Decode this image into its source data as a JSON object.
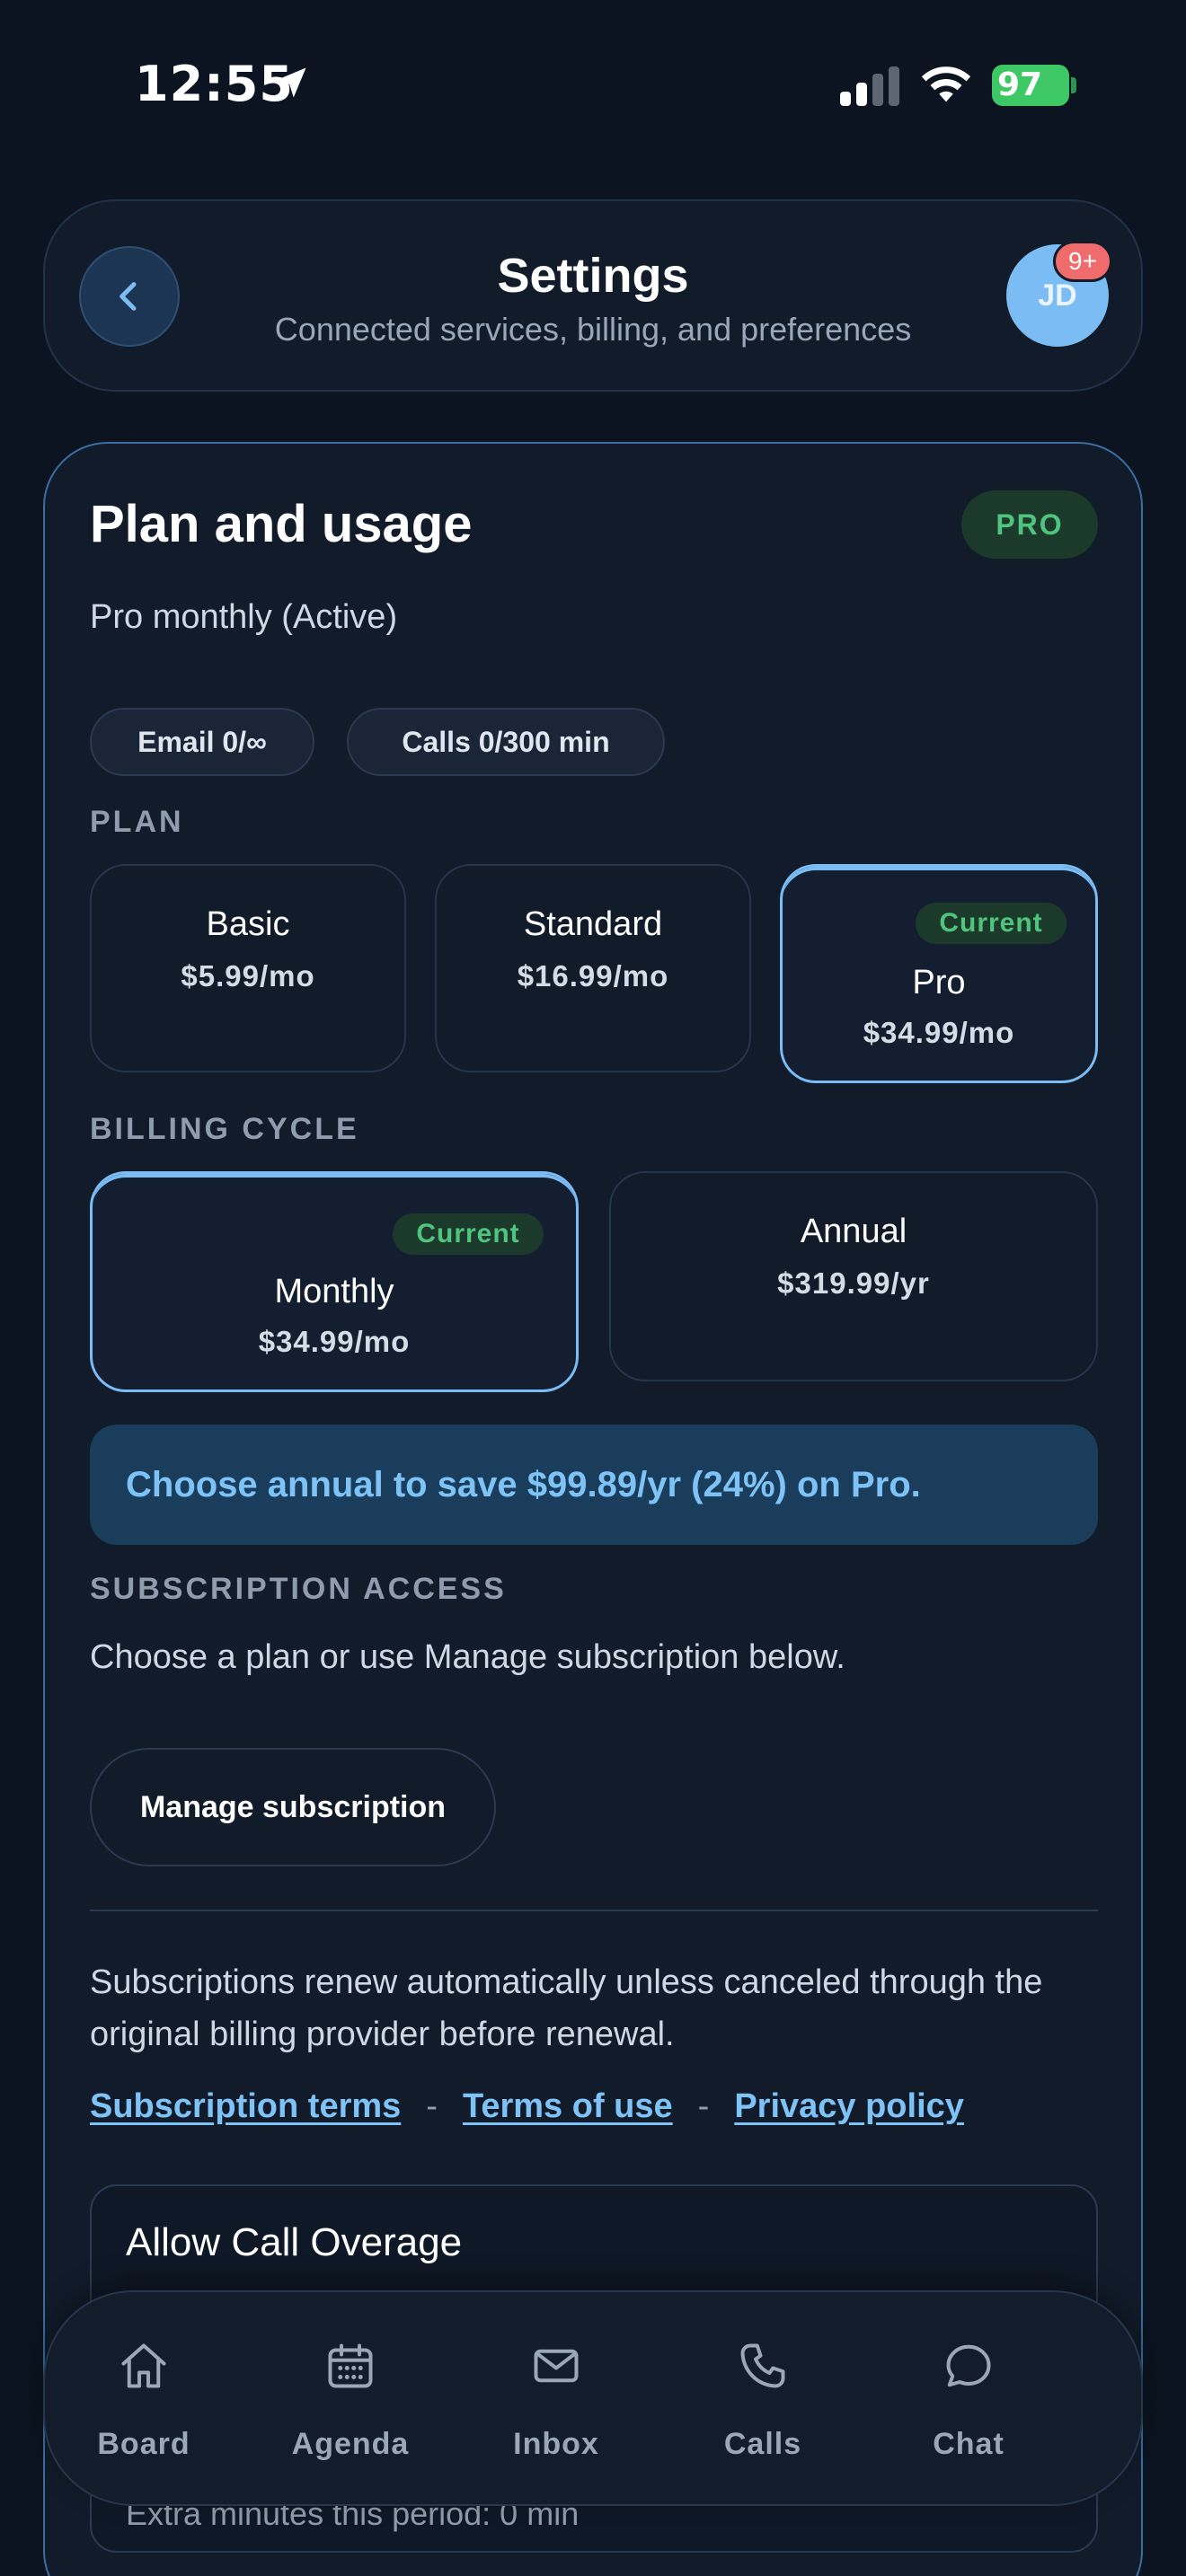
{
  "status_bar": {
    "time": "12:55",
    "battery": "97",
    "icons": [
      "location-arrow-icon",
      "signal-icon",
      "wifi-icon",
      "battery-icon"
    ]
  },
  "header": {
    "title": "Settings",
    "subtitle": "Connected services, billing, and preferences",
    "avatar_initials": "JD",
    "notification_count": "9+"
  },
  "plan_card": {
    "title": "Plan and usage",
    "badge": "PRO",
    "status": "Pro monthly (Active)",
    "chips": [
      {
        "label": "Email 0/∞"
      },
      {
        "label": "Calls 0/300 min"
      }
    ],
    "plan_label": "PLAN",
    "plans": [
      {
        "name": "Basic",
        "price": "$5.99/mo"
      },
      {
        "name": "Standard",
        "price": "$16.99/mo"
      },
      {
        "name": "Pro",
        "price": "$34.99/mo",
        "tag": "Current"
      }
    ],
    "billing_label": "BILLING CYCLE",
    "billing": [
      {
        "name": "Monthly",
        "price": "$34.99/mo",
        "tag": "Current"
      },
      {
        "name": "Annual",
        "price": "$319.99/yr"
      }
    ],
    "save_banner": "Choose annual to save $99.89/yr (24%) on Pro.",
    "access_label": "SUBSCRIPTION ACCESS",
    "access_text": "Choose a plan or use Manage subscription below.",
    "manage_button": "Manage subscription",
    "renew_text": "Subscriptions renew automatically unless canceled through the original billing provider before renewal.",
    "links": {
      "terms": "Subscription terms",
      "separator": "-",
      "terms_of_use": "Terms of use",
      "privacy": "Privacy policy"
    },
    "overage": {
      "title": "Allow Call Overage",
      "note": "Extra minutes this period: 0 min"
    }
  },
  "bottom_nav": [
    {
      "label": "Board",
      "icon": "home-icon"
    },
    {
      "label": "Agenda",
      "icon": "calendar-icon"
    },
    {
      "label": "Inbox",
      "icon": "mail-icon"
    },
    {
      "label": "Calls",
      "icon": "phone-icon"
    },
    {
      "label": "Chat",
      "icon": "chat-bubble-icon"
    }
  ],
  "colors": {
    "background": "#0b1420",
    "card": "#111b29",
    "accent": "#7bbcf5",
    "success": "#4fc47c",
    "battery": "#3dc765",
    "badge": "#f06b6b"
  }
}
